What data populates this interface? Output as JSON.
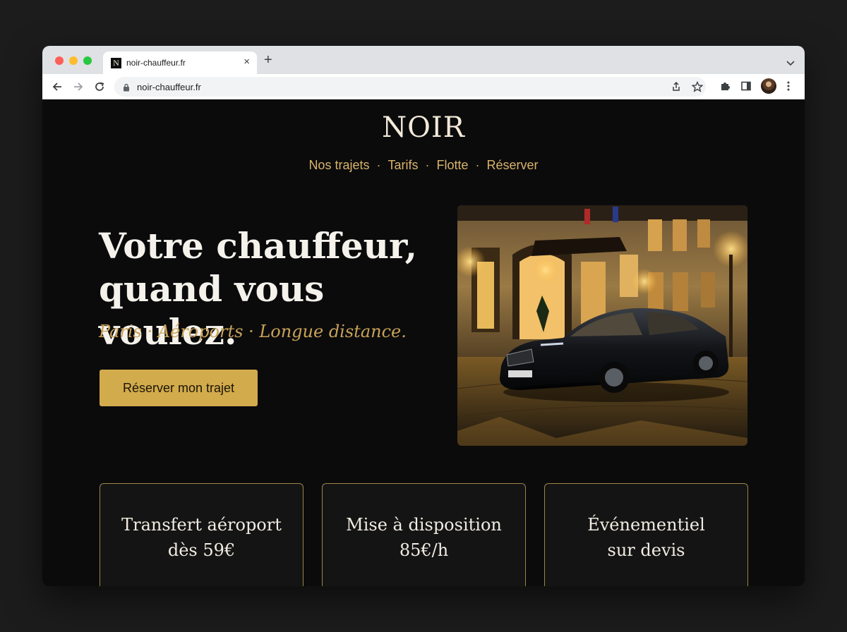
{
  "browser": {
    "tab": {
      "favicon": "N",
      "title": "noir-chauffeur.fr",
      "close": "×"
    },
    "new_tab": "+",
    "url": "noir-chauffeur.fr"
  },
  "site": {
    "logo": "NOIR",
    "nav": [
      {
        "label": "Nos trajets"
      },
      {
        "label": "Tarifs"
      },
      {
        "label": "Flotte"
      },
      {
        "label": "Réserver"
      }
    ],
    "nav_separator": "·",
    "hero": {
      "title_line1": "Votre chauffeur,",
      "title_line2": "quand vous voulez.",
      "tagline": "Paris · Aéroports · Longue distance.",
      "cta": "Réserver mon trajet",
      "image": "black-sedan-at-night-in-front-of-hotel"
    },
    "services": [
      {
        "line1": "Transfert aéroport",
        "line2": "dès 59€"
      },
      {
        "line1": "Mise à disposition",
        "line2": "85€/h"
      },
      {
        "line1": "Événementiel",
        "line2": "sur devis"
      }
    ]
  },
  "colors": {
    "background": "#0b0b0c",
    "gold": "#d2ab4c",
    "nav_gold": "#d9b46a",
    "text_light": "#f5f2ec"
  }
}
